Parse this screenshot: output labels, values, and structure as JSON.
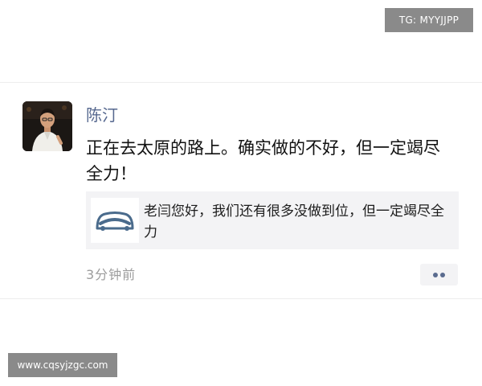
{
  "watermarks": {
    "top_right": "TG: MYYJJPP",
    "bottom_left": "www.cqsyjzgc.com"
  },
  "post": {
    "author": "陈汀",
    "text": "正在去太原的路上。确实做的不好，但一定竭尽全力！",
    "link_card": {
      "title": "老闫您好，我们还有很多没做到位，但一定竭尽全力",
      "thumbnail_icon": "car-logo-icon"
    },
    "timestamp": "3分钟前",
    "more_icon": "more-dots-icon"
  },
  "colors": {
    "name_link": "#56688f",
    "card_background": "#f3f3f5",
    "timestamp": "#9c9c9c",
    "logo_blue": "#4a6b8c"
  }
}
